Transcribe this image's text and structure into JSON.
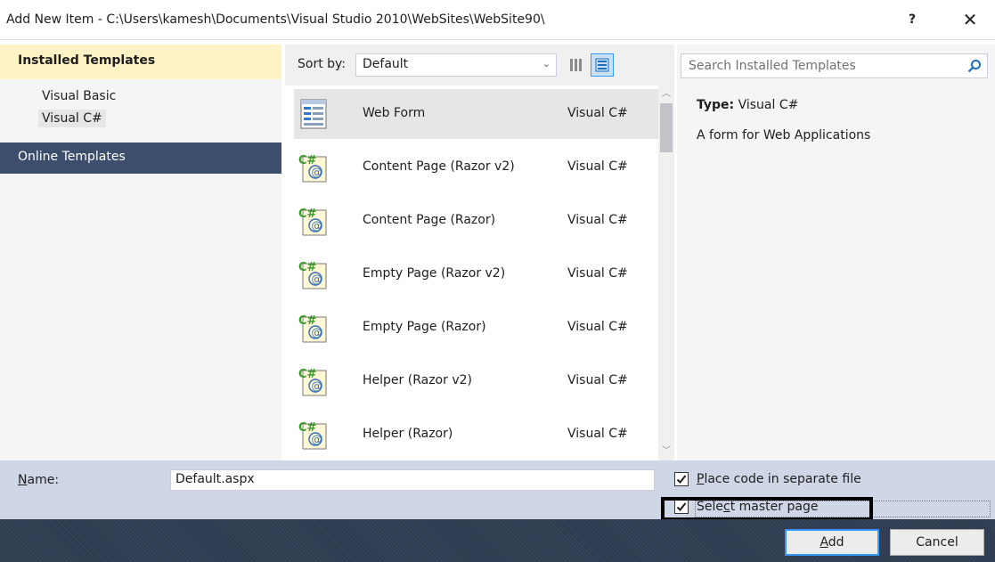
{
  "window": {
    "title": "Add New Item - C:\\Users\\kamesh\\Documents\\Visual Studio 2010\\WebSites\\WebSite90\\",
    "help_label": "?",
    "close_label": "✕"
  },
  "sidebar": {
    "installed_header": "Installed Templates",
    "items": [
      {
        "label": "Visual Basic"
      },
      {
        "label": "Visual C#"
      }
    ],
    "online_header": "Online Templates"
  },
  "toolbar": {
    "sort_label": "Sort by:",
    "sort_value": "Default",
    "sort_chevron": "⌄"
  },
  "templates": [
    {
      "name": "Web Form",
      "language": "Visual C#",
      "icon": "web-form-icon"
    },
    {
      "name": "Content Page (Razor v2)",
      "language": "Visual C#",
      "icon": "razor-page-icon"
    },
    {
      "name": "Content Page (Razor)",
      "language": "Visual C#",
      "icon": "razor-page-icon"
    },
    {
      "name": "Empty Page (Razor v2)",
      "language": "Visual C#",
      "icon": "razor-page-icon"
    },
    {
      "name": "Empty Page (Razor)",
      "language": "Visual C#",
      "icon": "razor-page-icon"
    },
    {
      "name": "Helper (Razor v2)",
      "language": "Visual C#",
      "icon": "razor-page-icon"
    },
    {
      "name": "Helper (Razor)",
      "language": "Visual C#",
      "icon": "razor-page-icon"
    }
  ],
  "search": {
    "placeholder": "Search Installed Templates"
  },
  "details": {
    "type_label": "Type:",
    "type_value": "Visual C#",
    "description": "A form for Web Applications"
  },
  "name_field": {
    "label_accel": "N",
    "label_rest": "ame:",
    "value": "Default.aspx"
  },
  "options": {
    "separate_file_accel": "P",
    "separate_file_rest": "lace code in separate file",
    "separate_file_checked": true,
    "master_page_pre": "Sele",
    "master_page_accel": "c",
    "master_page_rest": "t master page",
    "master_page_checked": true
  },
  "buttons": {
    "add_accel": "A",
    "add_rest": "dd",
    "cancel": "Cancel"
  },
  "colors": {
    "installed_header_bg": "#fff2c4",
    "online_header_bg": "#3c4e6b",
    "bottom_bg": "#cfd6e5",
    "footer_bg": "#2e3b50",
    "highlight_border": "#000000"
  }
}
